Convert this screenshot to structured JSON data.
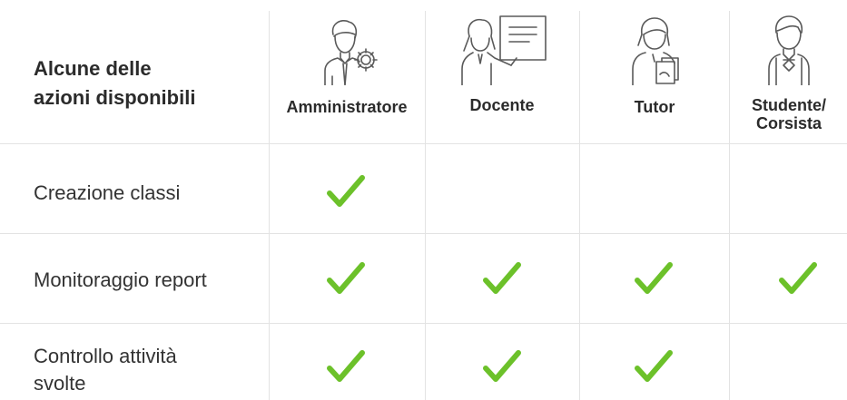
{
  "header": {
    "title_line1": "Alcune delle",
    "title_line2": "azioni disponibili"
  },
  "roles": [
    {
      "label": "Amministratore",
      "icon": "administrator-gear-icon"
    },
    {
      "label": "Docente",
      "icon": "teacher-whiteboard-icon"
    },
    {
      "label": "Tutor",
      "icon": "tutor-icon"
    },
    {
      "label_line1": "Studente/",
      "label_line2": "Corsista",
      "icon": "student-icon"
    }
  ],
  "rows": [
    {
      "label": "Creazione classi",
      "checks": [
        true,
        false,
        false,
        false
      ]
    },
    {
      "label": "Monitoraggio report",
      "checks": [
        true,
        true,
        true,
        true
      ]
    },
    {
      "label_line1": "Controllo attività",
      "label_line2": "svolte",
      "checks": [
        true,
        true,
        true,
        false
      ]
    }
  ],
  "colors": {
    "check": "#6cc12a",
    "divider": "#e3e3e3",
    "icon_stroke": "#5a5a5a"
  }
}
